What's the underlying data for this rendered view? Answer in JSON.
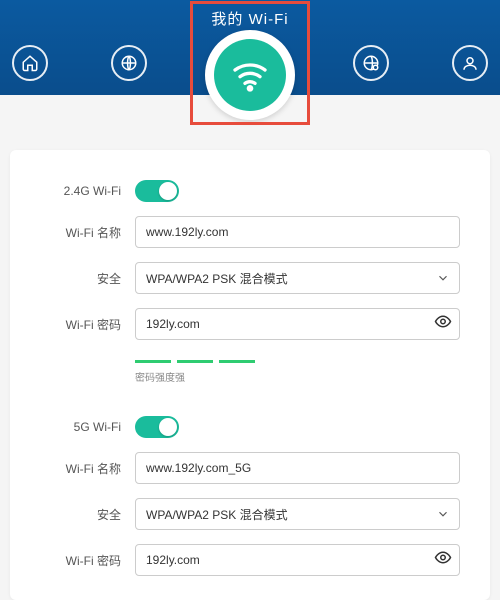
{
  "header": {
    "title": "我的 Wi-Fi"
  },
  "nav": {
    "home": "home-icon",
    "internet": "globe-icon",
    "wifi": "wifi-icon",
    "advanced": "globe-gear-icon",
    "user": "user-icon"
  },
  "wifi24": {
    "toggle_label": "2.4G Wi-Fi",
    "enabled": true,
    "name_label": "Wi-Fi 名称",
    "name_value": "www.192ly.com",
    "security_label": "安全",
    "security_value": "WPA/WPA2 PSK 混合模式",
    "password_label": "Wi-Fi 密码",
    "password_value": "192ly.com",
    "strength_label": "密码强度强"
  },
  "wifi5": {
    "toggle_label": "5G Wi-Fi",
    "enabled": true,
    "name_label": "Wi-Fi 名称",
    "name_value": "www.192ly.com_5G",
    "security_label": "安全",
    "security_value": "WPA/WPA2 PSK 混合模式",
    "password_label": "Wi-Fi 密码",
    "password_value": "192ly.com"
  }
}
